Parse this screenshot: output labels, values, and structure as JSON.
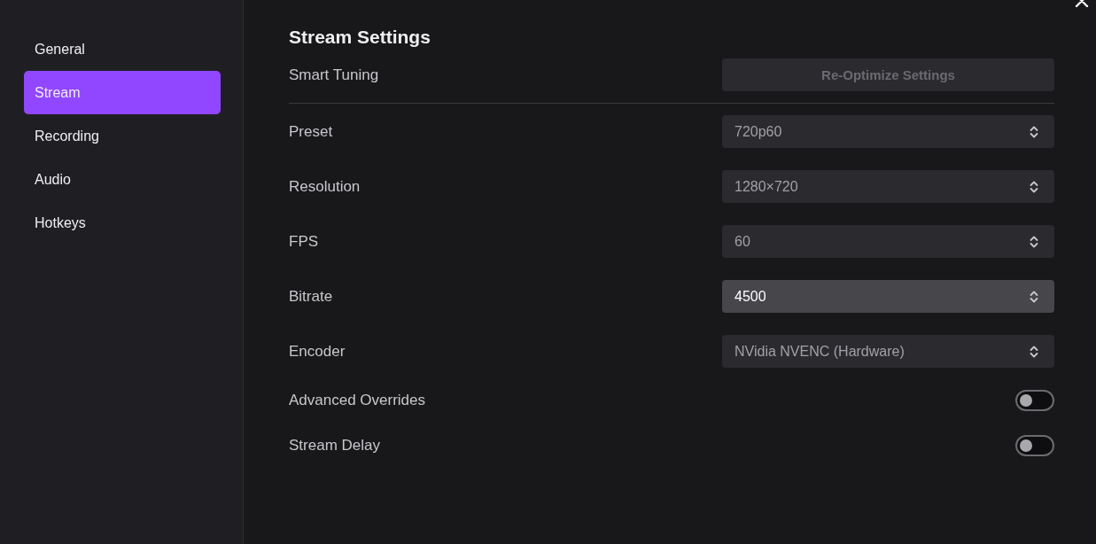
{
  "sidebar": {
    "items": [
      {
        "label": "General",
        "selected": false
      },
      {
        "label": "Stream",
        "selected": true
      },
      {
        "label": "Recording",
        "selected": false
      },
      {
        "label": "Audio",
        "selected": false
      },
      {
        "label": "Hotkeys",
        "selected": false
      }
    ]
  },
  "content": {
    "title": "Stream Settings",
    "rows": [
      {
        "kind": "button",
        "label": "Smart Tuning",
        "button": "Re-Optimize Settings",
        "disabled": true
      },
      {
        "kind": "select",
        "label": "Preset",
        "value": "720p60",
        "focused": false
      },
      {
        "kind": "select",
        "label": "Resolution",
        "value": "1280×720",
        "focused": false
      },
      {
        "kind": "select",
        "label": "FPS",
        "value": "60",
        "focused": false
      },
      {
        "kind": "select",
        "label": "Bitrate",
        "value": "4500",
        "focused": true
      },
      {
        "kind": "select",
        "label": "Encoder",
        "value": "NVidia NVENC (Hardware)",
        "focused": false
      },
      {
        "kind": "toggle",
        "label": "Advanced Overrides",
        "on": false
      },
      {
        "kind": "toggle",
        "label": "Stream Delay",
        "on": false
      }
    ]
  }
}
